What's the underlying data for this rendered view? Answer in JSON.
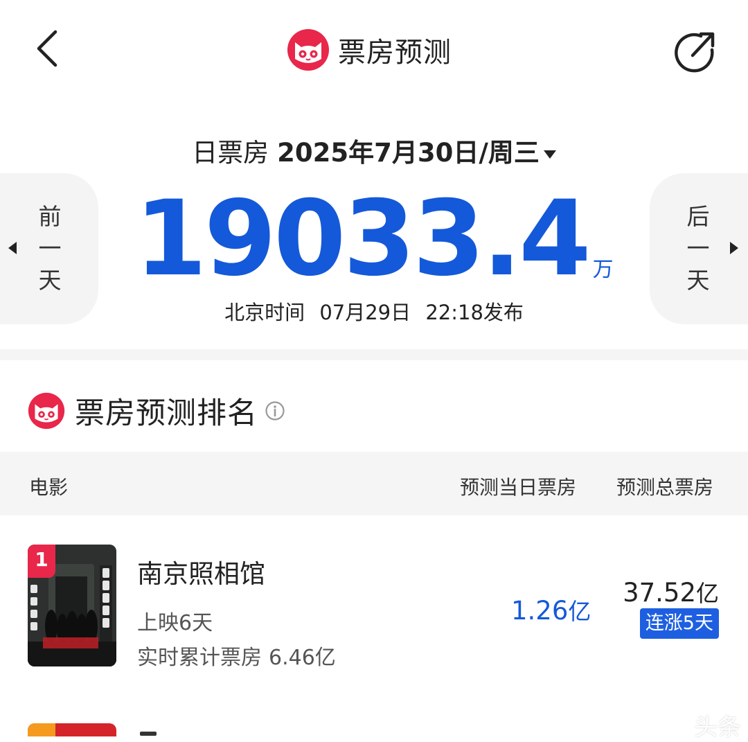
{
  "header": {
    "title": "票房预测",
    "back_icon": "chevron-left-icon",
    "share_icon": "share-icon",
    "logo_icon": "maoyan-cat-logo"
  },
  "summary": {
    "date_label": "日票房",
    "date_value": "2025年7月30日/周三",
    "prev_label": "前\n一\n天",
    "next_label": "后\n一\n天",
    "total_value": "19033.4",
    "total_unit": "万",
    "publish_prefix": "北京时间",
    "publish_date": "07月29日",
    "publish_time": "22:18发布"
  },
  "ranking": {
    "title": "票房预测排名",
    "columns": {
      "movie": "电影",
      "day_box_office": "预测当日票房",
      "total_box_office": "预测总票房"
    },
    "rows": [
      {
        "rank": "1",
        "name": "南京照相馆",
        "days_released": "上映6天",
        "cumulative_label": "实时累计票房",
        "cumulative_value": "6.46亿",
        "predicted_day": "1.26",
        "predicted_day_unit": "亿",
        "predicted_total": "37.52",
        "predicted_total_unit": "亿",
        "streak": "连涨5天"
      }
    ]
  },
  "watermark": "头条",
  "colors": {
    "accent_blue": "#1459d9",
    "brand_red": "#e8274a",
    "badge_blue": "#1d5fe0"
  }
}
